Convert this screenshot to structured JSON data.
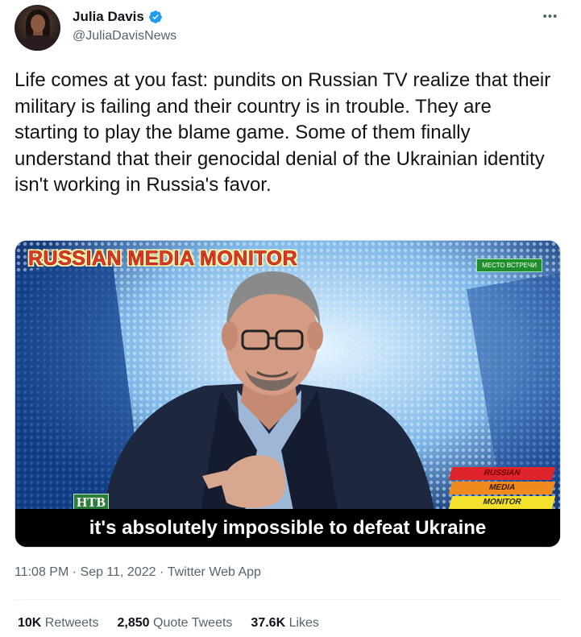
{
  "author": {
    "display_name": "Julia Davis",
    "handle": "@JuliaDavisNews",
    "verified": true
  },
  "more_icon_text": "•••",
  "tweet": {
    "text": "Life comes at you fast: pundits on Russian TV realize that their military is failing and their country is in trouble. They are starting to play the blame game. Some of them finally understand that their genocidal denial of the Ukrainian identity isn't working in Russia's favor."
  },
  "media": {
    "watermark": "RUSSIAN MEDIA MONITOR",
    "channel_bug": "МЕСТО ВСТРЕЧИ",
    "logo": "НТВ",
    "badge": [
      "RUSSIAN",
      "MEDIA",
      "MONITOR"
    ],
    "caption": "it's absolutely impossible to defeat Ukraine"
  },
  "meta": {
    "time": "11:08 PM",
    "sep1": " · ",
    "date": "Sep 11, 2022",
    "sep2": " · ",
    "source": "Twitter Web App"
  },
  "stats": {
    "retweets_count": "10K",
    "retweets_label": " Retweets",
    "quotes_count": "2,850",
    "quotes_label": " Quote Tweets",
    "likes_count": "37.6K",
    "likes_label": " Likes"
  },
  "colors": {
    "verified": "#1d9bf0",
    "secondary_text": "#536471",
    "primary_text": "#0f1419"
  }
}
